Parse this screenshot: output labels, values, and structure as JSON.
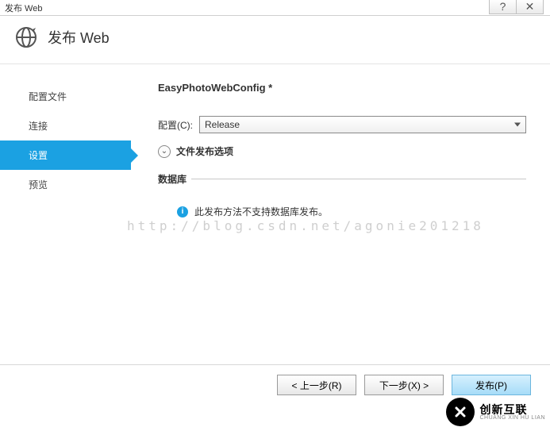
{
  "title": "发布 Web",
  "header": {
    "title": "发布 Web"
  },
  "sidebar": {
    "items": [
      {
        "label": "配置文件",
        "active": false
      },
      {
        "label": "连接",
        "active": false
      },
      {
        "label": "设置",
        "active": true
      },
      {
        "label": "预览",
        "active": false
      }
    ]
  },
  "content": {
    "config_name": "EasyPhotoWebConfig *",
    "config_label": "配置(C):",
    "config_value": "Release",
    "expand_label": "文件发布选项",
    "db_section": "数据库",
    "db_msg": "此发布方法不支持数据库发布。"
  },
  "watermark": "http://blog.csdn.net/agonie201218",
  "buttons": {
    "prev": "< 上一步(R)",
    "next": "下一步(X) >",
    "publish": "发布(P)"
  },
  "brand": {
    "main": "创新互联",
    "sub": "CHUANG XIN HU LIAN"
  }
}
